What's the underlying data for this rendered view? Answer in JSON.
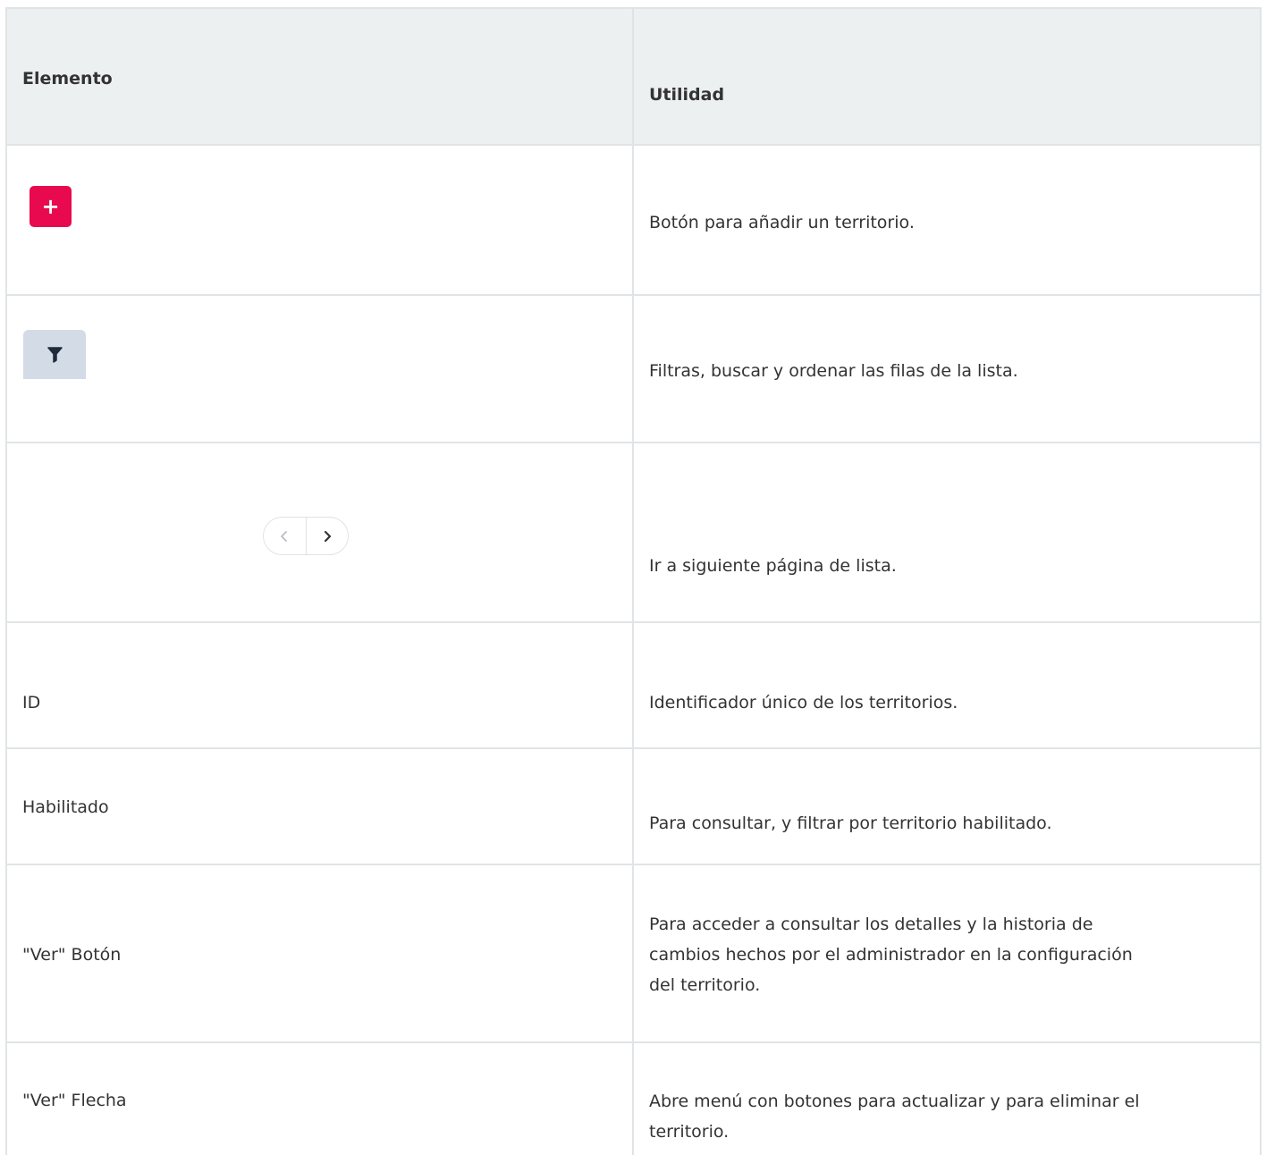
{
  "table": {
    "header": {
      "col1": "Elemento",
      "col2": "Utilidad"
    },
    "rows": [
      {
        "element_icon": "add-button",
        "element_glyph": "+",
        "description_lines": [
          "Botón para añadir un territorio."
        ]
      },
      {
        "element_icon": "filter-button",
        "description_lines": [
          "Filtras, buscar y ordenar las filas de la lista."
        ]
      },
      {
        "element_icon": "pagination-arrows",
        "prev_glyph": "‹",
        "next_glyph": "›",
        "description_lines": [
          "Ir a siguiente página de lista."
        ]
      },
      {
        "element": "ID",
        "description_lines": [
          "Identificador único de los territorios."
        ]
      },
      {
        "element": "Habilitado",
        "description_lines": [
          "Para consultar, y filtrar por territorio habilitado."
        ]
      },
      {
        "element": "\"Ver\" Botón",
        "description_lines": [
          "Para acceder a consultar los detalles y la historia de",
          "cambios hechos por el administrador en la configuración",
          "del territorio."
        ]
      },
      {
        "element": "\"Ver\" Flecha",
        "description_lines": [
          "Abre menú con botones para actualizar y para eliminar el",
          "territorio."
        ]
      }
    ]
  },
  "colors": {
    "add_button": "#e8094f",
    "filter_button": "#d3dbe6",
    "header_bg": "#edf0f1",
    "border": "#e1e4e6"
  }
}
